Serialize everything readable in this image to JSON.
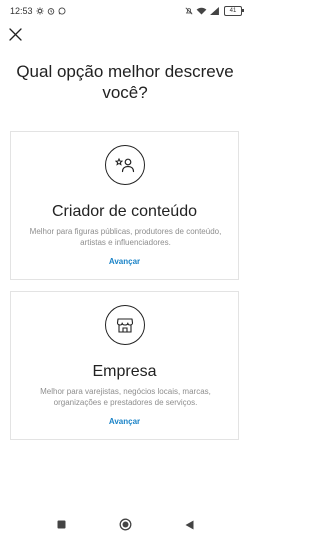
{
  "status_bar": {
    "time": "12:53",
    "battery": "41",
    "icons": [
      "settings-icon",
      "alarm-icon",
      "whatsapp-icon",
      "silent-icon",
      "wifi-icon",
      "signal-icon",
      "battery-icon"
    ]
  },
  "header": {
    "close_icon": "close-icon"
  },
  "title": "Qual opção melhor descreve você?",
  "options": [
    {
      "icon": "star-person-icon",
      "title": "Criador de conteúdo",
      "description": "Melhor para figuras públicas, produtores de conteúdo, artistas e influenciadores.",
      "action": "Avançar"
    },
    {
      "icon": "storefront-icon",
      "title": "Empresa",
      "description": "Melhor para varejistas, negócios locais, marcas, organizações e prestadores de serviços.",
      "action": "Avançar"
    }
  ],
  "colors": {
    "link": "#1a83c7",
    "text": "#222222",
    "muted": "#8e8e8e",
    "border": "#e3e3e3"
  },
  "nav_bar": {
    "icons": [
      "recents-icon",
      "home-icon",
      "back-icon"
    ]
  }
}
